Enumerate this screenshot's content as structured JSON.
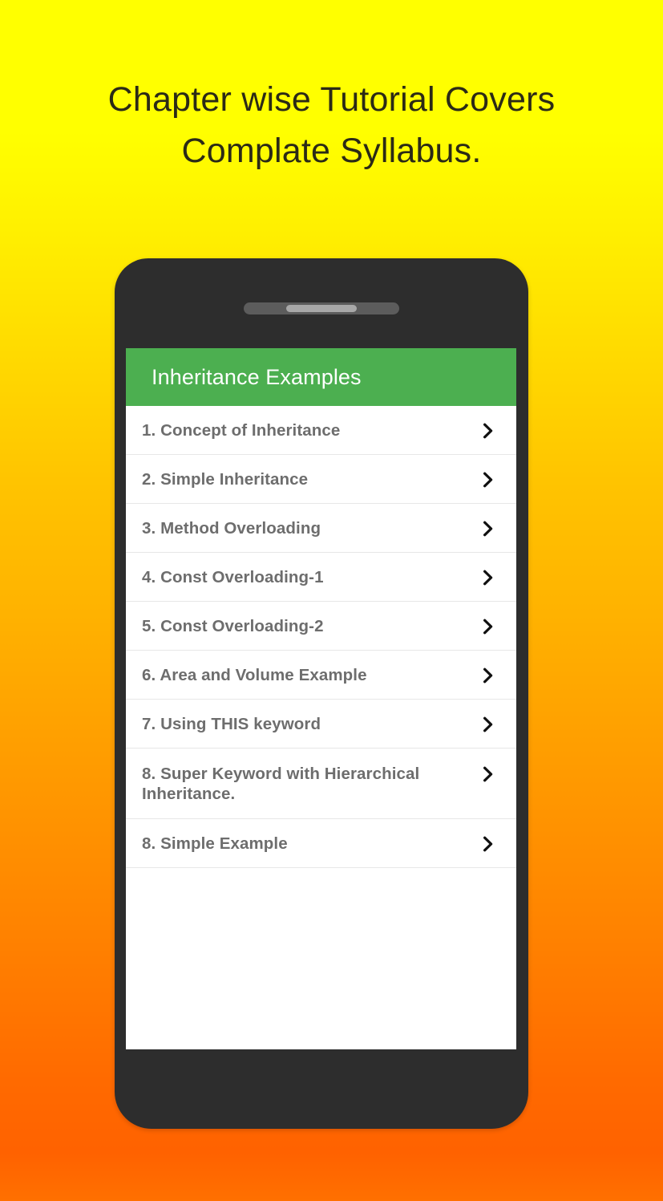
{
  "poster": {
    "headline": "Chapter wise Tutorial Covers\nComplate Syllabus.",
    "background_top_color": "#ffff00",
    "background_bottom_color": "#ff7000",
    "headline_color": "#2b2a16"
  },
  "phone": {
    "frame_color": "#2d2d2d",
    "speaker_icon": "speaker-grille-icon"
  },
  "app": {
    "appbar": {
      "title": "Inheritance Examples",
      "background_color": "#4caf50",
      "title_color": "#ffffff"
    },
    "list": {
      "item_text_color": "#6d6d6d",
      "divider_color": "#e7e7e7",
      "chevron_icon": "chevron-right-icon",
      "items": [
        {
          "label": "1. Concept of Inheritance",
          "two_line": false
        },
        {
          "label": "2. Simple Inheritance",
          "two_line": false
        },
        {
          "label": "3. Method Overloading",
          "two_line": false
        },
        {
          "label": "4. Const Overloading-1",
          "two_line": false
        },
        {
          "label": "5. Const Overloading-2",
          "two_line": false
        },
        {
          "label": "6. Area and Volume Example",
          "two_line": false
        },
        {
          "label": "7. Using THIS keyword",
          "two_line": false
        },
        {
          "label": "8. Super Keyword with Hierarchical Inheritance.",
          "two_line": true
        },
        {
          "label": "8. Simple Example",
          "two_line": false
        }
      ]
    }
  }
}
